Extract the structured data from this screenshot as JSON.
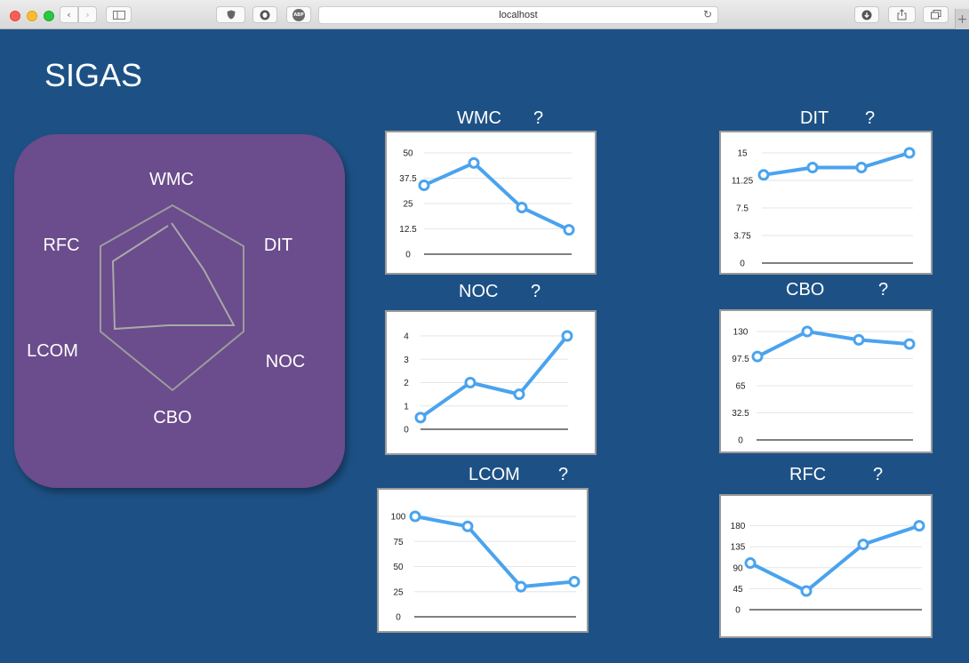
{
  "browser": {
    "address": "localhost",
    "ssl_icon": "shield-icon",
    "extension_icon": "ghostery-icon",
    "adblock_label": "ABP"
  },
  "app": {
    "title": "SIGAS"
  },
  "radar": {
    "labels": [
      "WMC",
      "DIT",
      "NOC",
      "CBO",
      "LCOM",
      "RFC"
    ]
  },
  "help_label": "?",
  "colors": {
    "background": "#1d5185",
    "card": "#6b4c8c",
    "line": "#4aa3ee"
  },
  "chart_data": [
    {
      "id": "wmc",
      "type": "line",
      "title": "WMC",
      "xlabel": "",
      "ylabel": "",
      "y_ticks": [
        "0",
        "12.5",
        "25",
        "37.5",
        "50"
      ],
      "ylim": [
        0,
        50
      ],
      "series": [
        {
          "values": [
            34,
            45,
            23,
            12
          ]
        }
      ]
    },
    {
      "id": "dit",
      "type": "line",
      "title": "DIT",
      "xlabel": "",
      "ylabel": "",
      "y_ticks": [
        "0",
        "3.75",
        "7.5",
        "11.25",
        "15"
      ],
      "ylim": [
        0,
        15
      ],
      "series": [
        {
          "values": [
            12,
            13,
            13,
            15
          ]
        }
      ]
    },
    {
      "id": "noc",
      "type": "line",
      "title": "NOC",
      "xlabel": "",
      "ylabel": "",
      "y_ticks": [
        "0",
        "1",
        "2",
        "3",
        "4"
      ],
      "ylim": [
        0,
        4
      ],
      "series": [
        {
          "values": [
            0.5,
            2,
            1.5,
            4
          ]
        }
      ]
    },
    {
      "id": "cbo",
      "type": "line",
      "title": "CBO",
      "xlabel": "",
      "ylabel": "",
      "y_ticks": [
        "0",
        "32.5",
        "65",
        "97.5",
        "130"
      ],
      "ylim": [
        0,
        130
      ],
      "series": [
        {
          "values": [
            100,
            130,
            120,
            115
          ]
        }
      ]
    },
    {
      "id": "lcom",
      "type": "line",
      "title": "LCOM",
      "xlabel": "",
      "ylabel": "",
      "y_ticks": [
        "0",
        "25",
        "50",
        "75",
        "100"
      ],
      "ylim": [
        0,
        100
      ],
      "series": [
        {
          "values": [
            100,
            90,
            30,
            35
          ]
        }
      ]
    },
    {
      "id": "rfc",
      "type": "line",
      "title": "RFC",
      "xlabel": "",
      "ylabel": "",
      "y_ticks": [
        "0",
        "45",
        "90",
        "135",
        "180"
      ],
      "ylim": [
        0,
        225
      ],
      "series": [
        {
          "values": [
            100,
            40,
            140,
            180
          ]
        }
      ]
    }
  ]
}
